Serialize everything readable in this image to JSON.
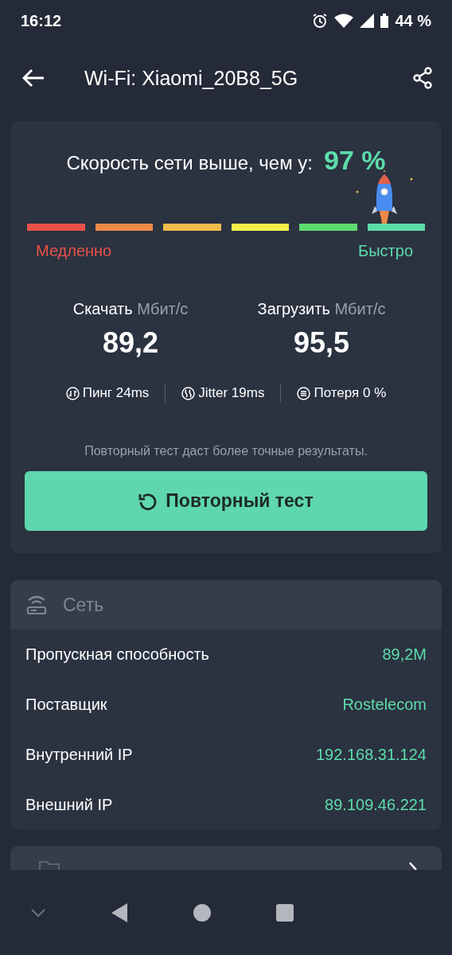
{
  "status_bar": {
    "time": "16:12",
    "battery": "44 %"
  },
  "app_bar": {
    "title": "Wi-Fi: Xiaomi_20B8_5G"
  },
  "result": {
    "headline": "Скорость сети выше, чем у:",
    "percent": "97 %",
    "scale": [
      {
        "color": "#e8524a"
      },
      {
        "color": "#ee8a48"
      },
      {
        "color": "#f0bb4c"
      },
      {
        "color": "#f6ee4a"
      },
      {
        "color": "#5ddc6e"
      },
      {
        "color": "#5ddcab"
      }
    ],
    "slow_label": "Медленно",
    "fast_label": "Быстро",
    "speeds": [
      {
        "label": "Скачать",
        "unit": "Мбит/с",
        "value": "89,2"
      },
      {
        "label": "Загрузить",
        "unit": "Мбит/с",
        "value": "95,5"
      }
    ],
    "metrics": [
      {
        "kind": "ping",
        "text": "Пинг 24ms"
      },
      {
        "kind": "jitter",
        "text": "Jitter 19ms"
      },
      {
        "kind": "loss",
        "text": "Потеря 0 %"
      }
    ],
    "hint": "Повторный тест даст более точные результаты.",
    "retest_button": "Повторный тест"
  },
  "network": {
    "title": "Сеть",
    "rows": [
      {
        "label": "Пропускная способность",
        "value": "89,2M"
      },
      {
        "label": "Поставщик",
        "value": "Rostelecom"
      },
      {
        "label": "Внутренний IP",
        "value": "192.168.31.124"
      },
      {
        "label": "Внешний IP",
        "value": "89.109.46.221"
      }
    ]
  }
}
